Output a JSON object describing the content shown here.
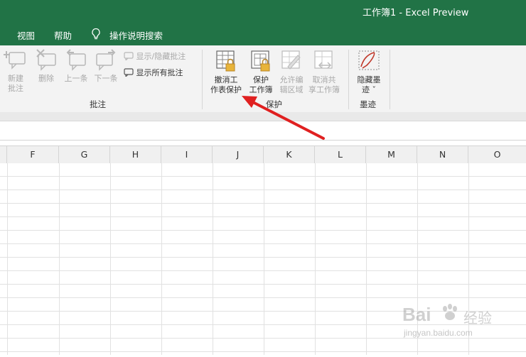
{
  "window": {
    "title": "工作簿1  -  Excel Preview"
  },
  "menu": {
    "items": [
      {
        "label": "视图"
      },
      {
        "label": "帮助"
      },
      {
        "label": "操作说明搜索"
      }
    ]
  },
  "ribbon": {
    "comments_group": {
      "label": "批注",
      "new_comment": [
        "新建",
        "批注"
      ],
      "delete": "删除",
      "previous": "上一条",
      "next": "下一条",
      "show_hide": "显示/隐藏批注",
      "show_all": "显示所有批注"
    },
    "protect_group": {
      "label": "保护",
      "unprotect_sheet": [
        "撤消工",
        "作表保护"
      ],
      "protect_workbook": [
        "保护",
        "工作簿"
      ],
      "allow_edit_ranges": [
        "允许编",
        "辑区域"
      ],
      "unshare_workbook": [
        "取消共",
        "享工作簿"
      ]
    },
    "ink_group": {
      "label": "墨迹",
      "hide_ink": [
        "隐藏墨",
        "迹 ˇ"
      ]
    }
  },
  "sheet": {
    "columns": [
      "F",
      "G",
      "H",
      "I",
      "J",
      "K",
      "L",
      "M",
      "N",
      "O"
    ]
  },
  "watermark": {
    "brand": "Bai",
    "brand2": "经验",
    "url": "jingyan.baidu.com"
  },
  "colors": {
    "excel_green": "#217346",
    "arrow_red": "#e02020",
    "disabled_text": "#a8a8a8"
  }
}
